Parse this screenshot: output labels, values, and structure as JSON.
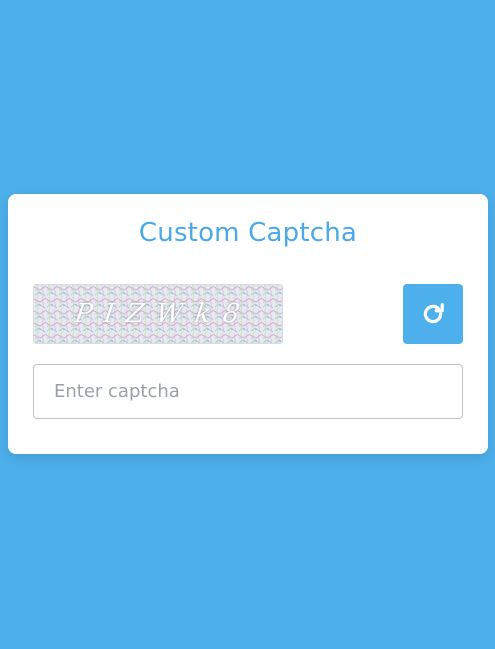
{
  "card": {
    "title": "Custom Captcha"
  },
  "captcha": {
    "characters": [
      "P",
      "I",
      "Z",
      "W",
      "k",
      "8"
    ],
    "refresh_icon": "rotate-right-icon"
  },
  "input": {
    "placeholder": "Enter captcha",
    "value": ""
  },
  "colors": {
    "page_background": "#4db0ec",
    "accent": "#4aa9e6",
    "card_background": "#ffffff"
  }
}
